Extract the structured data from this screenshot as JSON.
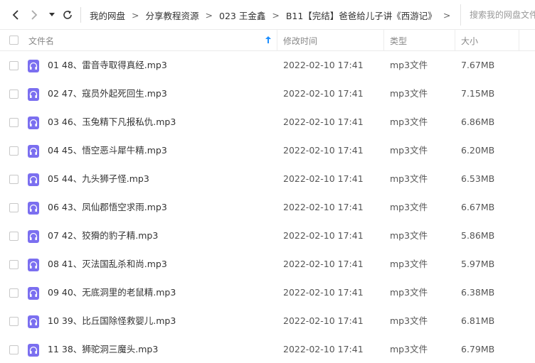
{
  "nav": {
    "back_icon": "chevron-left-icon",
    "forward_icon": "chevron-right-icon",
    "history_icon": "caret-down-icon",
    "refresh_icon": "refresh-icon"
  },
  "breadcrumb": {
    "items": [
      "我的网盘",
      "分享教程资源",
      "023 王金鑫",
      "B11【完结】爸爸给儿子讲《西游记》"
    ],
    "separator": ">"
  },
  "search": {
    "placeholder": "搜索我的网盘文件"
  },
  "table": {
    "headers": {
      "name": "文件名",
      "modified": "修改时间",
      "type": "类型",
      "size": "大小"
    },
    "sort_icon": "arrow-up-icon",
    "file_icon": "headphones-icon",
    "accent_color": "#1e8fff",
    "icon_color": "#7b6ff0",
    "rows": [
      {
        "name": "01 48、雷音寺取得真经.mp3",
        "modified": "2022-02-10 17:41",
        "type": "mp3文件",
        "size": "7.67MB"
      },
      {
        "name": "02 47、寇员外起死回生.mp3",
        "modified": "2022-02-10 17:41",
        "type": "mp3文件",
        "size": "7.15MB"
      },
      {
        "name": "03 46、玉兔精下凡报私仇.mp3",
        "modified": "2022-02-10 17:41",
        "type": "mp3文件",
        "size": "6.86MB"
      },
      {
        "name": "04 45、悟空恶斗犀牛精.mp3",
        "modified": "2022-02-10 17:41",
        "type": "mp3文件",
        "size": "6.20MB"
      },
      {
        "name": "05 44、九头狮子怪.mp3",
        "modified": "2022-02-10 17:41",
        "type": "mp3文件",
        "size": "6.53MB"
      },
      {
        "name": "06 43、凤仙郡悟空求雨.mp3",
        "modified": "2022-02-10 17:41",
        "type": "mp3文件",
        "size": "6.67MB"
      },
      {
        "name": "07 42、狡猾的豹子精.mp3",
        "modified": "2022-02-10 17:41",
        "type": "mp3文件",
        "size": "5.86MB"
      },
      {
        "name": "08 41、灭法国乱杀和尚.mp3",
        "modified": "2022-02-10 17:41",
        "type": "mp3文件",
        "size": "5.97MB"
      },
      {
        "name": "09 40、无底洞里的老鼠精.mp3",
        "modified": "2022-02-10 17:41",
        "type": "mp3文件",
        "size": "6.38MB"
      },
      {
        "name": "10 39、比丘国除怪救婴儿.mp3",
        "modified": "2022-02-10 17:41",
        "type": "mp3文件",
        "size": "6.81MB"
      },
      {
        "name": "11 38、狮驼洞三魔头.mp3",
        "modified": "2022-02-10 17:41",
        "type": "mp3文件",
        "size": "6.79MB"
      }
    ]
  }
}
